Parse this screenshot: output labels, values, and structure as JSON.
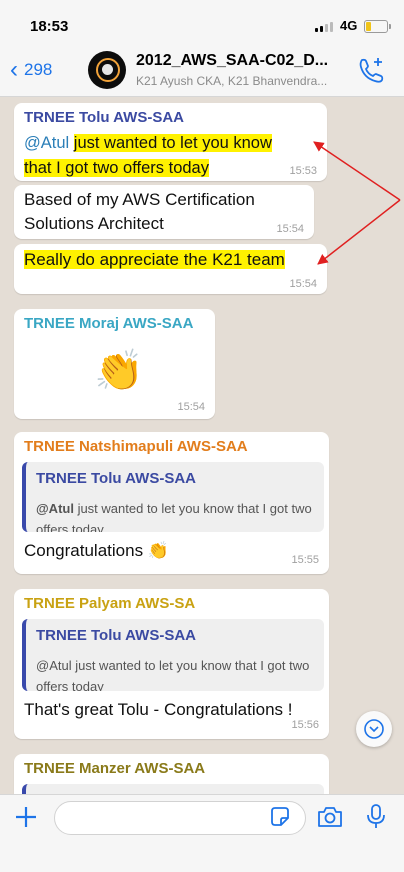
{
  "status_bar": {
    "time": "18:53",
    "network": "4G"
  },
  "header": {
    "back_count": "298",
    "title": "2012_AWS_SAA-C02_D...",
    "subtitle": "K21 Ayush CKA, K21 Bhanvendra..."
  },
  "colors": {
    "accent": "#1e74e8",
    "highlight": "#fff200",
    "chat_background": "#e4ddd5",
    "arrow": "#e02020"
  },
  "messages": [
    {
      "sender": "TRNEE Tolu AWS-SAA",
      "sender_color": "#3b4aa2",
      "mention": "@Atul",
      "line1_highlight": "just wanted to let you know",
      "line2_highlight": "that I got two offers today",
      "time": "15:53"
    },
    {
      "line1": "Based of my AWS Certification",
      "line2": "Solutions Architect",
      "time": "15:54"
    },
    {
      "line1_highlight": "Really do appreciate the K21 team",
      "time": "15:54"
    },
    {
      "sender": "TRNEE Moraj AWS-SAA",
      "sender_color": "#3aa7c4",
      "emoji": "👏",
      "time": "15:54"
    },
    {
      "sender": "TRNEE Natshimapuli AWS-SAA",
      "sender_color": "#e27d1c",
      "quote_sender": "TRNEE Tolu AWS-SAA",
      "quote_mention": "@Atul",
      "quote_text": " just wanted to let you know that I got two offers today",
      "text": "Congratulations 👏",
      "time": "15:55"
    },
    {
      "sender": "TRNEE Palyam AWS-SA",
      "sender_color": "#c9a213",
      "quote_sender": "TRNEE Tolu AWS-SAA",
      "quote_text": "@Atul just wanted to let you know that I got two offers today",
      "text": "That's great Tolu - Congratulations !",
      "time": "15:56"
    },
    {
      "sender": "TRNEE Manzer AWS-SAA",
      "sender_color": "#8a7a1a"
    }
  ],
  "icons": {
    "back": "chevron-left-icon",
    "call": "phone-add-icon",
    "scroll": "chevron-down-icon",
    "attach": "plus-icon",
    "sticker": "sticker-icon",
    "camera": "camera-icon",
    "mic": "microphone-icon"
  }
}
